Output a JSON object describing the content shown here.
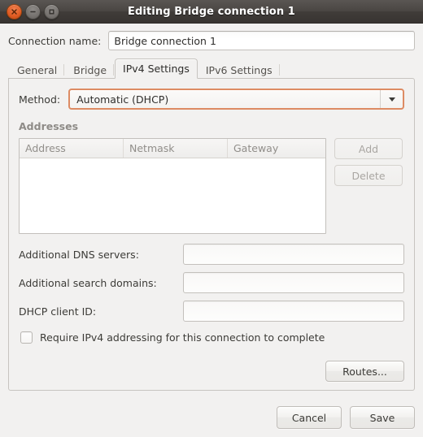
{
  "window": {
    "title": "Editing Bridge connection 1",
    "controls": [
      {
        "name": "close",
        "glyph": "×"
      },
      {
        "name": "minimize",
        "glyph": "–"
      },
      {
        "name": "maximize",
        "glyph": "□"
      }
    ],
    "accent_color": "#dd4814",
    "titlebar_color": "#413d3a",
    "background_color": "#f2f1f0"
  },
  "connection": {
    "label": "Connection name:",
    "value": "Bridge connection 1",
    "placeholder": ""
  },
  "tabs": [
    {
      "label": "General",
      "active": false
    },
    {
      "label": "Bridge",
      "active": false
    },
    {
      "label": "IPv4 Settings",
      "active": true
    },
    {
      "label": "IPv6 Settings",
      "active": false
    }
  ],
  "ipv4": {
    "method": {
      "label": "Method:",
      "value": "Automatic (DHCP)",
      "focused": true
    },
    "addresses": {
      "section_label": "Addresses",
      "columns": [
        "Address",
        "Netmask",
        "Gateway"
      ],
      "rows": [],
      "add_label": "Add",
      "delete_label": "Delete",
      "add_enabled": false,
      "delete_enabled": false
    },
    "fields": [
      {
        "label": "Additional DNS servers:",
        "value": "",
        "placeholder": ""
      },
      {
        "label": "Additional search domains:",
        "value": "",
        "placeholder": ""
      },
      {
        "label": "DHCP client ID:",
        "value": "",
        "placeholder": ""
      }
    ],
    "require_ipv4": {
      "label": "Require IPv4 addressing for this connection to complete",
      "checked": false
    },
    "routes_label": "Routes..."
  },
  "actions": {
    "cancel_label": "Cancel",
    "save_label": "Save"
  }
}
